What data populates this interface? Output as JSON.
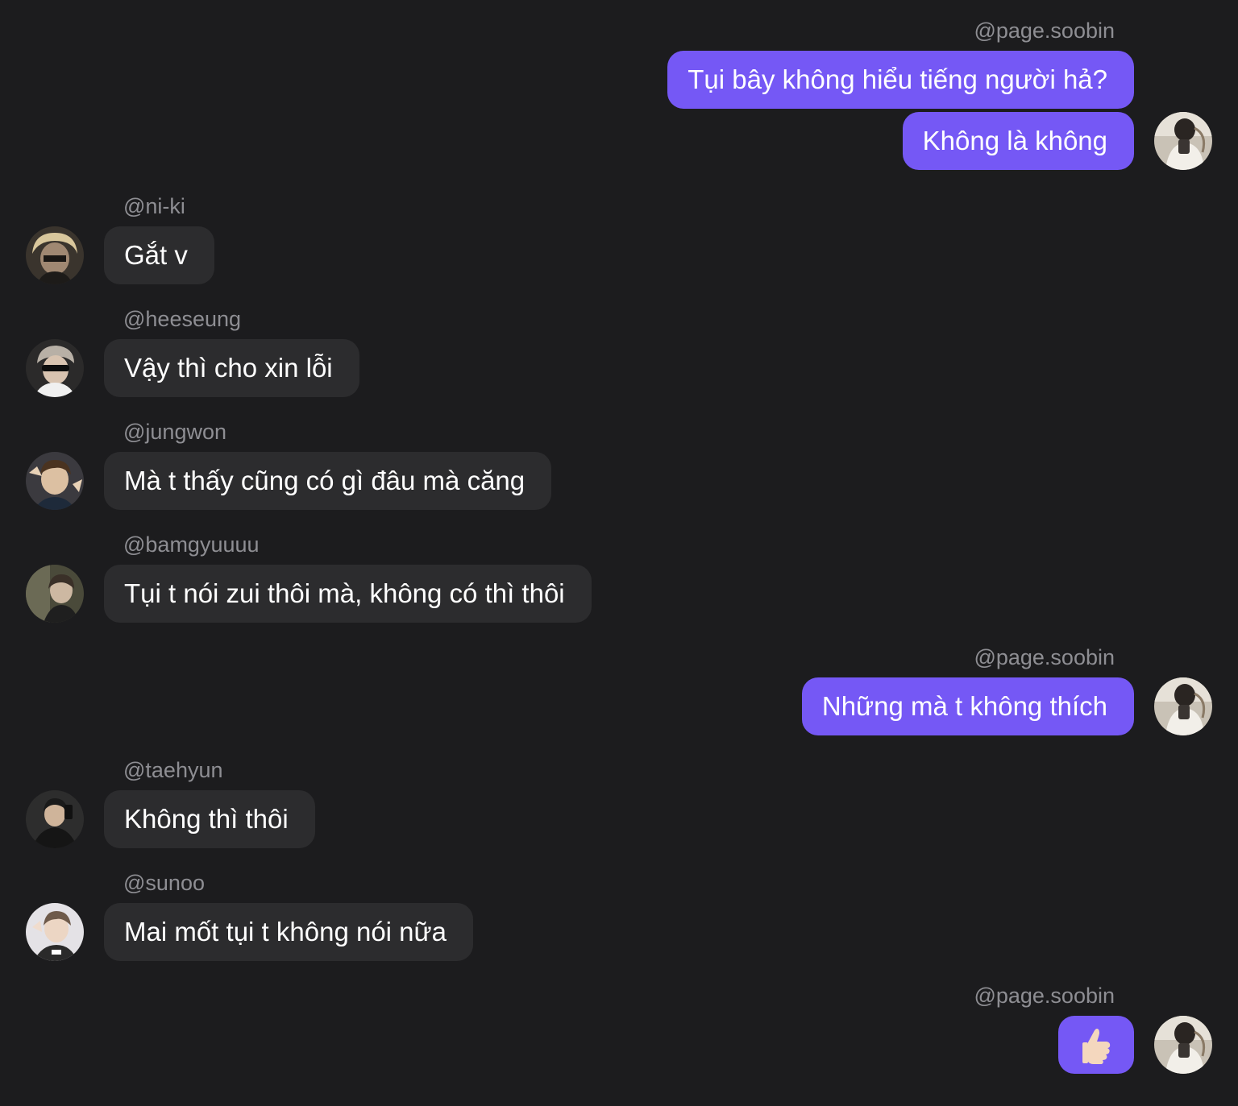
{
  "messages": [
    {
      "user": "@page.soobin",
      "side": "out",
      "text": "Tụi bây không hiểu tiếng người hả?"
    },
    {
      "user": "@page.soobin",
      "side": "out",
      "text": "Không là không"
    },
    {
      "user": "@ni-ki",
      "side": "in",
      "text": "Gắt v"
    },
    {
      "user": "@heeseung",
      "side": "in",
      "text": "Vậy thì cho xin lỗi"
    },
    {
      "user": "@jungwon",
      "side": "in",
      "text": "Mà t thấy cũng có gì đâu mà căng"
    },
    {
      "user": "@bamgyuuuu",
      "side": "in",
      "text": "Tụi t nói zui thôi mà, không có thì thôi"
    },
    {
      "user": "@page.soobin",
      "side": "out",
      "text": "Những mà t không thích"
    },
    {
      "user": "@taehyun",
      "side": "in",
      "text": "Không thì thôi"
    },
    {
      "user": "@sunoo",
      "side": "in",
      "text": "Mai mốt tụi t không nói nữa"
    },
    {
      "user": "@page.soobin",
      "side": "out",
      "text": "",
      "icon": "thumbs-up-icon"
    }
  ],
  "colors": {
    "background": "#1c1c1e",
    "outgoing_bubble": "#7558f5",
    "incoming_bubble": "#2c2c2e",
    "username": "#8e8e93"
  }
}
